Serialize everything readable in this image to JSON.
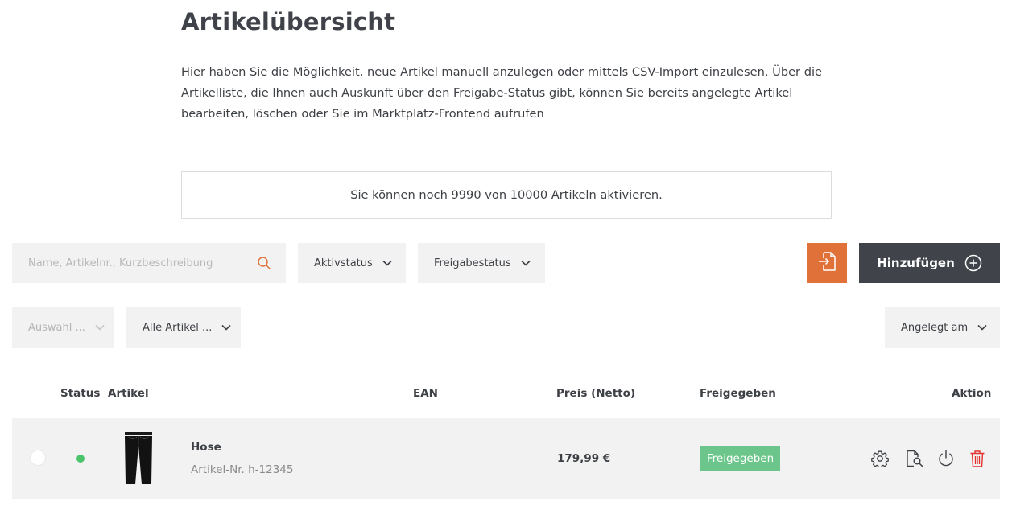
{
  "page": {
    "title": "Artikelübersicht",
    "intro": "Hier haben Sie die Möglichkeit, neue Artikel manuell anzulegen oder mittels CSV-Import einzulesen. Über die Artikelliste, die Ihnen auch Auskunft über den Freigabe-Status gibt, können Sie bereits angelegte Artikel bearbeiten, löschen oder Sie im Marktplatz-Frontend aufrufen",
    "quota_text": "Sie können noch 9990 von 10000 Artikeln aktivieren."
  },
  "toolbar": {
    "search_placeholder": "Name, Artikelnr., Kurzbeschreibung",
    "search_value": "",
    "filter_active": "Aktivstatus",
    "filter_approval": "Freigabestatus",
    "add_label": "Hinzufügen"
  },
  "subtoolbar": {
    "selection": "Auswahl ...",
    "all_articles": "Alle Artikel ...",
    "sort": "Angelegt am"
  },
  "table": {
    "headers": {
      "status": "Status",
      "article": "Artikel",
      "ean": "EAN",
      "price": "Preis (Netto)",
      "approved": "Freigegeben",
      "action": "Aktion"
    },
    "rows": [
      {
        "name": "Hose",
        "sku": "Artikel-Nr. h-12345",
        "ean": "",
        "price": "179,99 €",
        "approval": "Freigegeben",
        "status": "active"
      }
    ]
  },
  "colors": {
    "accent_orange": "#e07139",
    "button_dark": "#40434a",
    "status_active": "#4cc46a",
    "badge_approved": "#6cc68b",
    "delete_red": "#e3312f",
    "panel_grey": "#f2f2f2"
  },
  "icons": {
    "search": "search-icon",
    "chevron": "chevron-down-icon",
    "import": "file-import-icon",
    "add": "plus-circle-icon",
    "settings": "gear-icon",
    "preview": "document-search-icon",
    "toggle": "power-icon",
    "delete": "trash-icon"
  }
}
